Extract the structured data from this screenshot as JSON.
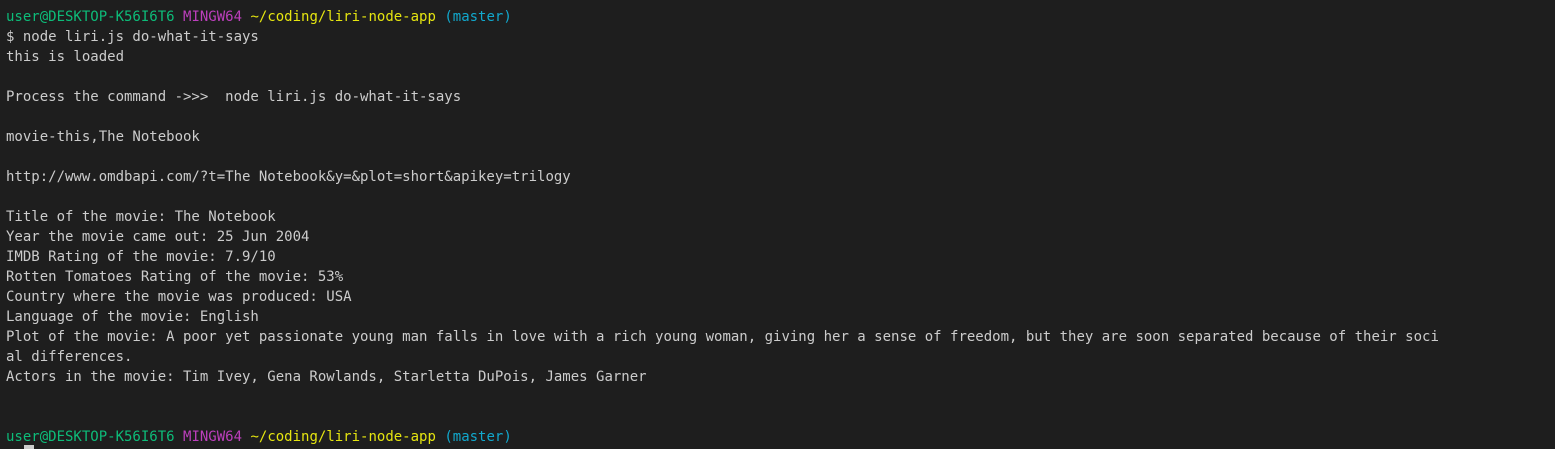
{
  "terminal": {
    "prompt1": {
      "user": "user@DESKTOP-K56I6T6",
      "host": "MINGW64",
      "path": "~/coding/liri-node-app",
      "branch": "(master)"
    },
    "command": "$ node liri.js do-what-it-says",
    "output": {
      "loaded": "this is loaded",
      "process": "Process the command ->>>  node liri.js do-what-it-says",
      "file_content": "movie-this,The Notebook",
      "url": "http://www.omdbapi.com/?t=The Notebook&y=&plot=short&apikey=trilogy",
      "title": "Title of the movie: The Notebook",
      "year": "Year the movie came out: 25 Jun 2004",
      "imdb": "IMDB Rating of the movie: 7.9/10",
      "rotten": "Rotten Tomatoes Rating of the movie: 53%",
      "country": "Country where the movie was produced: USA",
      "language": "Language of the movie: English",
      "plot_line1": "Plot of the movie: A poor yet passionate young man falls in love with a rich young woman, giving her a sense of freedom, but they are soon separated because of their soci",
      "plot_line2": "al differences.",
      "actors": "Actors in the movie: Tim Ivey, Gena Rowlands, Starletta DuPois, James Garner"
    },
    "prompt2": {
      "user": "user@DESKTOP-K56I6T6",
      "host": "MINGW64",
      "path": "~/coding/liri-node-app",
      "branch": "(master)"
    }
  },
  "colors": {
    "background": "#1e1e1e",
    "text": "#cccccc",
    "prompt_user": "#0dbc79",
    "prompt_host": "#bc3fbc",
    "prompt_path": "#e5e510",
    "prompt_branch": "#11a8cd"
  }
}
